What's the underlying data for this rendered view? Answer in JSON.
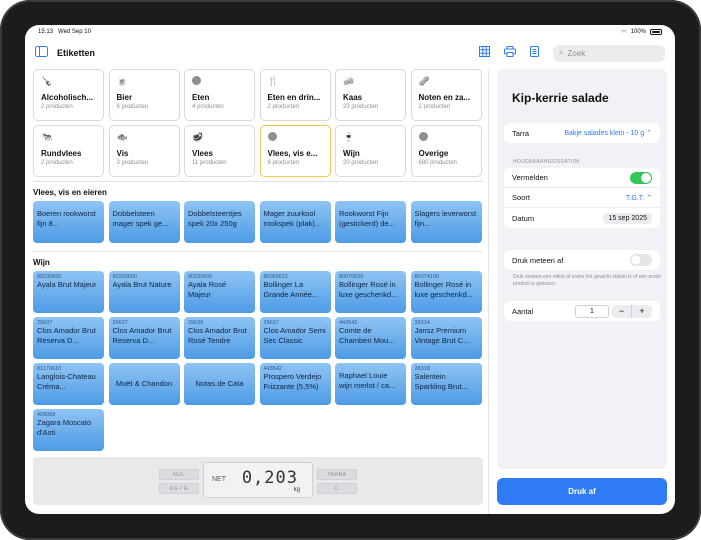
{
  "status": {
    "time": "15:13",
    "date": "Wed Sep 10",
    "battery": "100%"
  },
  "nav": {
    "title": "Etiketten",
    "search_placeholder": "Zoek"
  },
  "categories": [
    {
      "name": "Alcoholisch...",
      "count": "2 producten",
      "icon": "bottle-icon"
    },
    {
      "name": "Bier",
      "count": "6 producten",
      "icon": "beer-icon"
    },
    {
      "name": "Eten",
      "count": "4 producten",
      "icon": "dot-icon"
    },
    {
      "name": "Eten en drin...",
      "count": "2 producten",
      "icon": "fork-knife-icon"
    },
    {
      "name": "Kaas",
      "count": "23 producten",
      "icon": "cheese-icon"
    },
    {
      "name": "Noten en za...",
      "count": "2 producten",
      "icon": "nuts-icon"
    },
    {
      "name": "Rundvlees",
      "count": "2 producten",
      "icon": "cow-icon"
    },
    {
      "name": "Vis",
      "count": "3 producten",
      "icon": "fish-icon"
    },
    {
      "name": "Vlees",
      "count": "11 producten",
      "icon": "meat-icon"
    },
    {
      "name": "Vlees, vis e...",
      "count": "6 producten",
      "icon": "dot-icon",
      "selected": true
    },
    {
      "name": "Wijn",
      "count": "20 producten",
      "icon": "wine-glass-icon"
    },
    {
      "name": "Overige",
      "count": "680 producten",
      "icon": "dot-icon"
    }
  ],
  "section1": {
    "title": "Vlees, vis en eieren",
    "items": [
      {
        "code": "",
        "name": "Boeren rookworst fijn 8..."
      },
      {
        "code": "",
        "name": "Dobbelsteen mager spek ge..."
      },
      {
        "code": "",
        "name": "Dobbelsteentjes spek 20x 250g"
      },
      {
        "code": "",
        "name": "Mager zuurkool rookspek (plak)..."
      },
      {
        "code": "",
        "name": "Rookworst Fijn (gestickerd) de..."
      },
      {
        "code": "",
        "name": "Slagers leverworst fijn..."
      }
    ]
  },
  "section2": {
    "title": "Wijn",
    "items": [
      {
        "code": "80230600",
        "name": "Ayala Brut Majeur"
      },
      {
        "code": "80230600",
        "name": "Ayala Brut Nature"
      },
      {
        "code": "80230600",
        "name": "Ayala Rosé Majeur"
      },
      {
        "code": "80050612",
        "name": "Bollinger La Grande Année..."
      },
      {
        "code": "80070650",
        "name": "Bollinger Rosé in luxe geschenkd..."
      },
      {
        "code": "80074100",
        "name": "Bollinger Rosé in luxe geschenkd..."
      },
      {
        "code": "29637",
        "name": "Clos Amador Brut Reserva D..."
      },
      {
        "code": "29637",
        "name": "Clos Amador Brut Reserva D..."
      },
      {
        "code": "29636",
        "name": "Clos Amador Brut Rosé Tendre"
      },
      {
        "code": "29637",
        "name": "Clos Amador Semi Sec Classic"
      },
      {
        "code": "443542",
        "name": "Comte de Chamberi Mou..."
      },
      {
        "code": "28314",
        "name": "Jansz Premium Vintage Brut C..."
      },
      {
        "code": "81170610",
        "name": "Langlois-Chateau Crémа..."
      },
      {
        "code": "",
        "name": "Moët & Chandon",
        "center": true
      },
      {
        "code": "",
        "name": "Notas de Cata",
        "center": true
      },
      {
        "code": "443542",
        "name": "Prospero Verdejo Frizzante (5,5%)"
      },
      {
        "code": "",
        "name": "Raphael Louie wijn merlot / ca..."
      },
      {
        "code": "28318",
        "name": "Salentein Sparkling Brut..."
      },
      {
        "code": "409068",
        "name": "Zagara Moscato d'Asti"
      }
    ]
  },
  "scale": {
    "nul": "NUL",
    "kgg": "KG / G",
    "tarra": "TARRA",
    "c": "C",
    "net": "NET",
    "value": "0,203",
    "unit": "kg"
  },
  "panel": {
    "title": "Kip-kerrie salade",
    "tarra_label": "Tarra",
    "tarra_value": "Bakje salades klein - 10 g",
    "houdbaarheid_header": "HOUDBAARHEIDSDATUM",
    "vermelden_label": "Vermelden",
    "vermelden_on": true,
    "soort_label": "Soort",
    "soort_value": "T.G.T.",
    "datum_label": "Datum",
    "datum_value": "15 sep 2025",
    "druk_label": "Druk meteen af",
    "druk_on": false,
    "druk_note": "Druk meteen een etiket af zodra het gewicht stabiel is of een ander product is gekozen.",
    "aantal_label": "Aantal",
    "aantal_value": "1",
    "minus": "−",
    "plus": "+",
    "print_button": "Druk af"
  },
  "colors": {
    "accent": "#2f7bf6",
    "tile": "#6aaeec",
    "toggle_on": "#34c759",
    "selected_border": "#f2c94c"
  }
}
